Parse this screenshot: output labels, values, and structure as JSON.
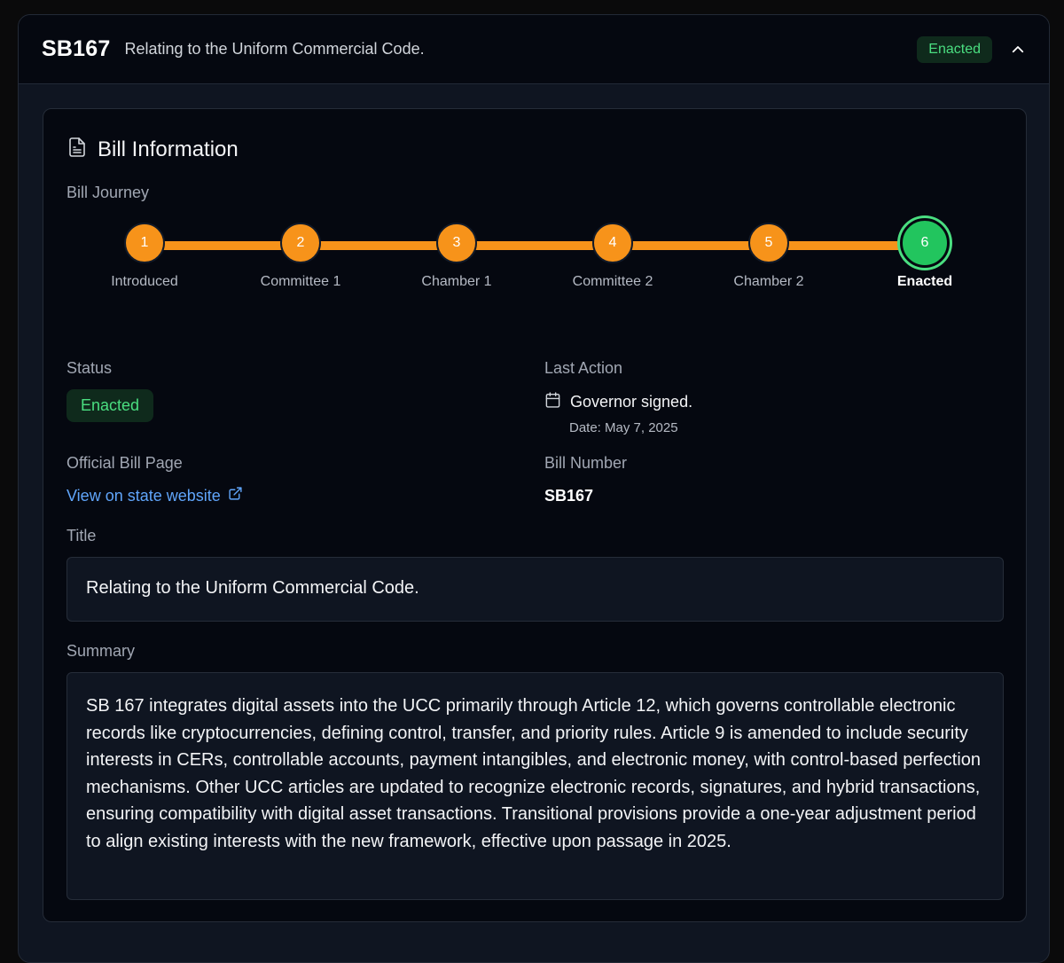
{
  "header": {
    "bill_code": "SB167",
    "short_title": "Relating to the Uniform Commercial Code.",
    "status_badge": "Enacted"
  },
  "section": {
    "title": "Bill Information",
    "journey_label": "Bill Journey"
  },
  "journey": {
    "steps": [
      {
        "number": "1",
        "label": "Introduced"
      },
      {
        "number": "2",
        "label": "Committee 1"
      },
      {
        "number": "3",
        "label": "Chamber 1"
      },
      {
        "number": "4",
        "label": "Committee 2"
      },
      {
        "number": "5",
        "label": "Chamber 2"
      },
      {
        "number": "6",
        "label": "Enacted"
      }
    ],
    "current_step": 6
  },
  "status": {
    "label": "Status",
    "value": "Enacted"
  },
  "last_action": {
    "label": "Last Action",
    "text": "Governor signed.",
    "date": "Date: May 7, 2025"
  },
  "official_page": {
    "label": "Official Bill Page",
    "link_text": "View on state website"
  },
  "bill_number": {
    "label": "Bill Number",
    "value": "SB167"
  },
  "title": {
    "label": "Title",
    "value": "Relating to the Uniform Commercial Code."
  },
  "summary": {
    "label": "Summary",
    "value": "SB 167 integrates digital assets into the UCC primarily through Article 12, which governs controllable electronic records like cryptocurrencies, defining control, transfer, and priority rules. Article 9 is amended to include security interests in CERs, controllable accounts, payment intangibles, and electronic money, with control-based perfection mechanisms. Other UCC articles are updated to recognize electronic records, signatures, and hybrid transactions, ensuring compatibility with digital asset transactions. Transitional provisions provide a one-year adjustment period to align existing interests with the new framework, effective upon passage in 2025."
  },
  "colors": {
    "accent_orange": "#f7931a",
    "enacted_green": "#22c55e",
    "link_blue": "#60a5fa"
  },
  "icons": {
    "section": "document-icon",
    "collapse": "chevron-up-icon",
    "calendar": "calendar-icon",
    "external": "external-link-icon"
  }
}
